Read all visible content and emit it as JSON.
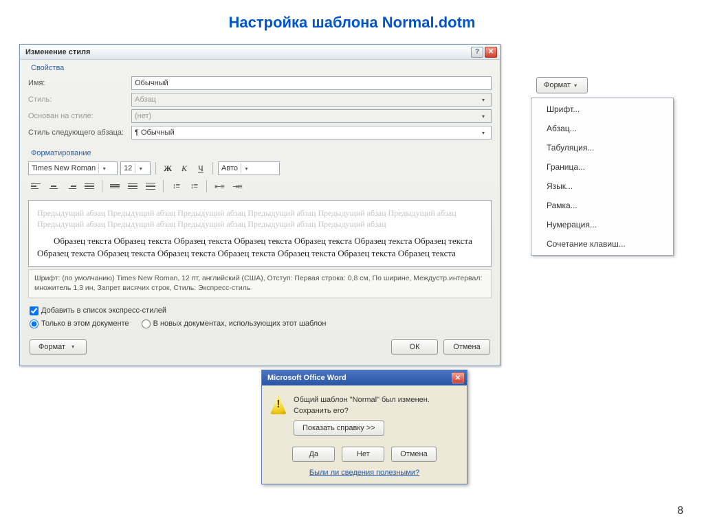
{
  "slide": {
    "title": "Настройка шаблона Normal.dotm",
    "page": "8"
  },
  "dialog": {
    "title": "Изменение стиля",
    "section_props": "Свойства",
    "section_format": "Форматирование",
    "fields": {
      "name_label": "Имя:",
      "name_value": "Обычный",
      "styletype_label": "Стиль:",
      "styletype_value": "Абзац",
      "basedon_label": "Основан на стиле:",
      "basedon_value": "(нет)",
      "nextstyle_label": "Стиль следующего абзаца:",
      "nextstyle_value": "¶ Обычный"
    },
    "toolbar": {
      "font": "Times New Roman",
      "size": "12",
      "bold": "Ж",
      "italic": "К",
      "underline": "Ч",
      "color": "Авто"
    },
    "preview": {
      "faded": "Предыдущий абзац Предыдущий абзац Предыдущий абзац Предыдущий абзац Предыдущий абзац Предыдущий абзац Предыдущий абзац Предыдущий абзац Предыдущий абзац Предыдущий абзац Предыдущий абзац",
      "sample": "Образец текста Образец текста Образец текста Образец текста Образец текста Образец текста Образец текста Образец текста Образец текста Образец текста Образец текста Образец текста Образец текста Образец текста"
    },
    "summary": "Шрифт: (по умолчанию) Times New Roman, 12 пт, английский (США), Отступ: Первая строка:  0,8 см, По ширине, Междустр.интервал: множитель 1,3 ин, Запрет висячих строк, Стиль: Экспресс-стиль",
    "check_quick": "Добавить в список экспресс-стилей",
    "radio_doc": "Только в этом документе",
    "radio_tpl": "В новых документах, использующих этот шаблон",
    "format_btn": "Формат",
    "ok": "ОК",
    "cancel": "Отмена"
  },
  "format_menu": {
    "button": "Формат",
    "items": [
      "Шрифт...",
      "Абзац...",
      "Табуляция...",
      "Граница...",
      "Язык...",
      "Рамка...",
      "Нумерация...",
      "Сочетание клавиш..."
    ]
  },
  "confirm": {
    "title": "Microsoft Office Word",
    "text": "Общий шаблон \"Normal\" был изменен.  Сохранить его?",
    "help": "Показать справку >>",
    "yes": "Да",
    "no": "Нет",
    "cancel": "Отмена",
    "link": "Были ли сведения полезными?"
  }
}
